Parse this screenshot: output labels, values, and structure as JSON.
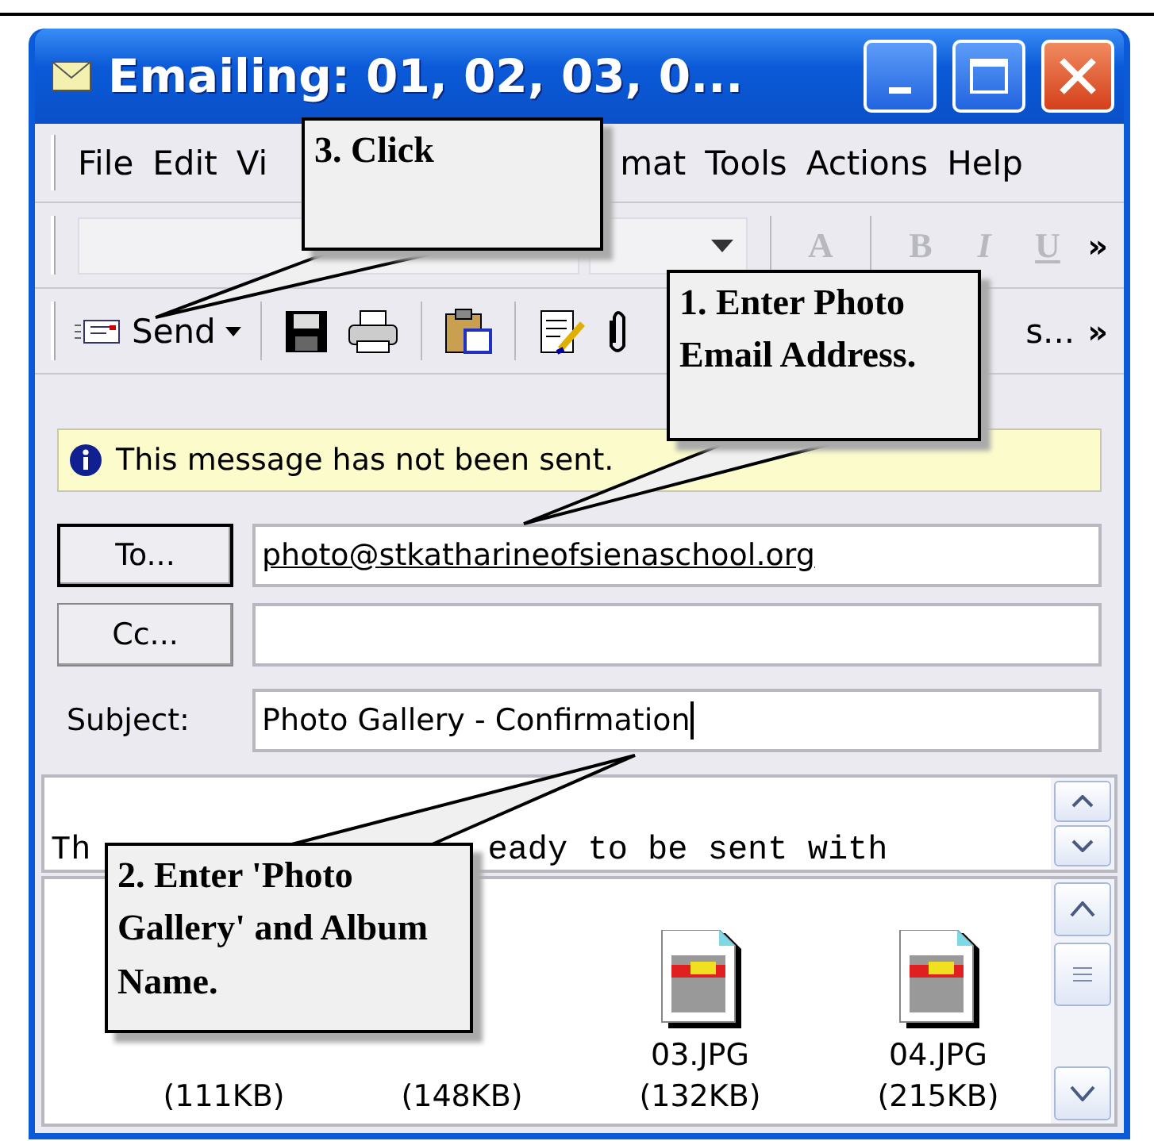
{
  "window": {
    "title": "Emailing: 01, 02, 03, 0..."
  },
  "menu": [
    {
      "label": "File"
    },
    {
      "label": "Edit"
    },
    {
      "label": "Vi"
    },
    {
      "label": "mat"
    },
    {
      "label": "Tools"
    },
    {
      "label": "Actions"
    },
    {
      "label": "Help"
    }
  ],
  "format_toolbar": {
    "buttons": [
      {
        "label": "A",
        "disabled": true
      },
      {
        "label": "B",
        "disabled": true
      },
      {
        "label": "I",
        "disabled": true
      },
      {
        "label": "U",
        "disabled": true
      }
    ],
    "overflow": "»"
  },
  "standard_toolbar": {
    "send": "Send",
    "trailing_text": "s...",
    "overflow": "»"
  },
  "info_bar": {
    "text": "This message has not been sent."
  },
  "recipients": [
    {
      "button": "To...",
      "value": "photo@stkatharineofsienaschool.org"
    },
    {
      "button": "Cc..."
    }
  ],
  "subject": {
    "label": "Subject:",
    "value": "Photo Gallery - Confirmation"
  },
  "body": {
    "texts": [
      "Th",
      "eady to be sent with"
    ]
  },
  "attachments": [
    {
      "size": "(111KB)"
    },
    {
      "size": "(148KB)"
    },
    {
      "name": "03.JPG",
      "size": "(132KB)"
    },
    {
      "name": "04.JPG",
      "size": "(215KB)"
    }
  ],
  "callouts": [
    {
      "text": "3. Click"
    },
    {
      "text": "1. Enter Photo Email Address."
    },
    {
      "text": "2. Enter 'Photo Gallery' and Album Name."
    }
  ]
}
